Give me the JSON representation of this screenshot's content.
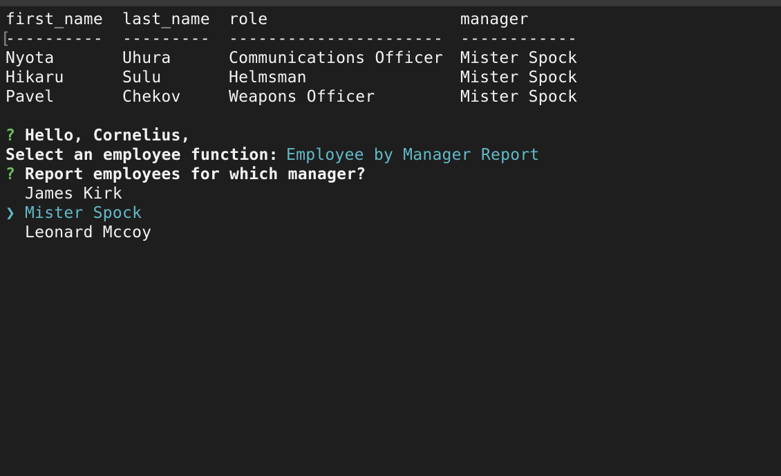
{
  "table": {
    "headers": [
      "first_name",
      "last_name",
      "role",
      "manager"
    ],
    "separators": [
      "----------",
      "---------",
      "----------------------",
      "------------"
    ],
    "rows": [
      [
        "Nyota",
        "Uhura",
        "Communications Officer",
        "Mister Spock"
      ],
      [
        "Hikaru",
        "Sulu",
        "Helmsman",
        "Mister Spock"
      ],
      [
        "Pavel",
        "Chekov",
        "Weapons Officer",
        "Mister Spock"
      ]
    ]
  },
  "prompt": {
    "marker": "?",
    "greeting": "Hello, Cornelius,",
    "function_label": "Select an employee function:",
    "function_answer": "Employee by Manager Report",
    "question": "Report employees for which manager?",
    "pointer": "❯",
    "options": [
      "James Kirk",
      "Mister Spock",
      "Leonard Mccoy"
    ],
    "selected_index": 1
  },
  "colors": {
    "background": "#1e1e1e",
    "text": "#f2f2f2",
    "prompt_marker": "#6fbf5f",
    "highlight": "#62b9c8"
  }
}
